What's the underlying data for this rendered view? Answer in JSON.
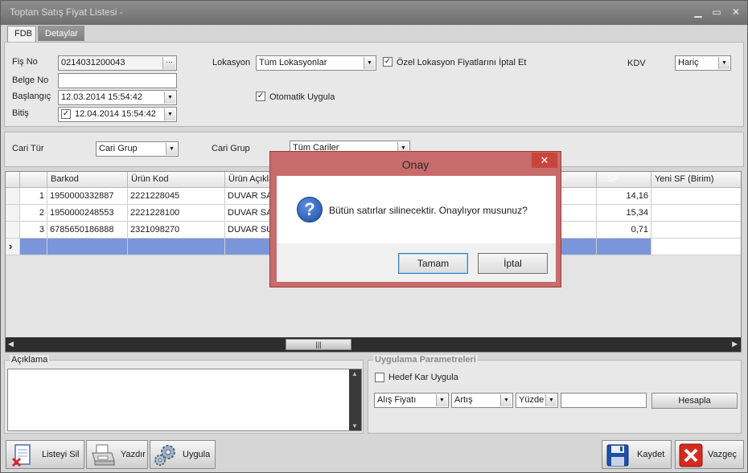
{
  "window": {
    "title": "Toptan Satış Fiyat Listesi -",
    "minimize_glyph": "▁",
    "maximize_glyph": "▭",
    "close_glyph": "✕"
  },
  "tabs": [
    {
      "label": "FDB",
      "active": true
    },
    {
      "label": "Detaylar",
      "active": false
    }
  ],
  "form": {
    "fis_no_label": "Fiş No",
    "fis_no_value": "0214031200043",
    "fis_no_button": "···",
    "belge_no_label": "Belge No",
    "belge_no_value": "",
    "baslangic_label": "Başlangıç",
    "baslangic_value": "12.03.2014 15:54:42",
    "bitis_label": "Bitiş",
    "bitis_value": "12.04.2014 15:54:42",
    "bitis_checked": true,
    "lokasyon_label": "Lokasyon",
    "lokasyon_value": "Tüm Lokasyonlar",
    "ozel_lokasyon_label": "Özel Lokasyon Fiyatlarını İptal Et",
    "ozel_lokasyon_checked": true,
    "otomatik_uygula_label": "Otomatik Uygula",
    "otomatik_uygula_checked": true,
    "kdv_label": "KDV",
    "kdv_value": "Hariç"
  },
  "filters": {
    "cari_tur_label": "Cari Tür",
    "cari_tur_value": "Cari Grup",
    "cari_grup_label": "Cari Grup",
    "cari_grup_value": "Tüm Cariler"
  },
  "grid": {
    "columns": [
      "Barkod",
      "Ürün Kod",
      "Ürün Açıkla",
      "...SF",
      "Yeni SF (Birim)"
    ],
    "rows": [
      {
        "no": "1",
        "barkod": "1950000332887",
        "urun_kod": "2221228045",
        "urun_aciklama": "DUVAR SAA",
        "sf": "14,16",
        "yeni_sf": ""
      },
      {
        "no": "2",
        "barkod": "1950000248553",
        "urun_kod": "2221228100",
        "urun_aciklama": "DUVAR SAA",
        "sf": "15,34",
        "yeni_sf": ""
      },
      {
        "no": "3",
        "barkod": "6785650186888",
        "urun_kod": "2321098270",
        "urun_aciklama": "DUVAR SUS",
        "sf": "0,71",
        "yeni_sf": ""
      }
    ],
    "new_row_indicator": "›",
    "scroll_left": "◀",
    "scroll_right": "▶",
    "scroll_thumb": "|||"
  },
  "aciklama": {
    "title": "Açıklama",
    "value": "",
    "scroll_up": "▲",
    "scroll_down": "▼"
  },
  "uygulama": {
    "title": "Uygulama Parametreleri",
    "hedef_kar_label": "Hedef Kar Uygula",
    "hedef_kar_checked": false,
    "fiyat_tipi": "Alış Fiyatı",
    "islem": "Artış",
    "oran_tipi": "Yüzde",
    "deger": "",
    "hesapla_label": "Hesapla"
  },
  "toolbar": {
    "listeyi_sil": "Listeyi Sil",
    "yazdir": "Yazdır",
    "uygula": "Uygula",
    "kaydet": "Kaydet",
    "vazgec": "Vazgeç"
  },
  "dialog": {
    "title": "Onay",
    "close_glyph": "✕",
    "icon_glyph": "?",
    "message": "Bütün satırlar silinecektir. Onaylıyor musunuz?",
    "ok_label": "Tamam",
    "cancel_label": "İptal"
  }
}
